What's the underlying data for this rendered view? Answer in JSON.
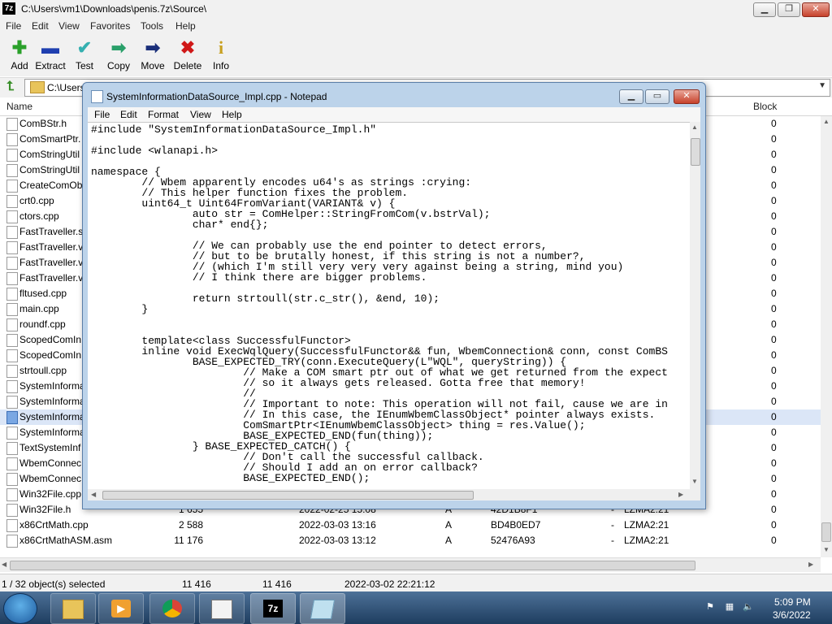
{
  "sevenzip": {
    "title": "C:\\Users\\vm1\\Downloads\\penis.7z\\Source\\",
    "app_icon": "7z",
    "menu": [
      "File",
      "Edit",
      "View",
      "Favorites",
      "Tools",
      "Help"
    ],
    "toolbar": [
      {
        "label": "Add",
        "icon": "plus-icon",
        "glyph": "✚",
        "color": "#2aa02a"
      },
      {
        "label": "Extract",
        "icon": "minus-icon",
        "glyph": "▬",
        "color": "#1f3fb0"
      },
      {
        "label": "Test",
        "icon": "checkmark-icon",
        "glyph": "✔",
        "color": "#35b0b0"
      },
      {
        "label": "Copy",
        "icon": "copy-arrow-icon",
        "glyph": "➡",
        "color": "#2aa06a"
      },
      {
        "label": "Move",
        "icon": "move-arrow-icon",
        "glyph": "➡",
        "color": "#1a2f7a"
      },
      {
        "label": "Delete",
        "icon": "delete-x-icon",
        "glyph": "✖",
        "color": "#d01818"
      },
      {
        "label": "Info",
        "icon": "info-icon",
        "glyph": "i",
        "color": "#c8a020"
      }
    ],
    "address": "C:\\Users",
    "columns": {
      "name": "Name",
      "block": "Block"
    },
    "files": [
      {
        "name": "ComBStr.h",
        "block": "0"
      },
      {
        "name": "ComSmartPtr.",
        "block": "0"
      },
      {
        "name": "ComStringUtil",
        "block": "0"
      },
      {
        "name": "ComStringUtil",
        "block": "0"
      },
      {
        "name": "CreateComOb",
        "block": "0"
      },
      {
        "name": "crt0.cpp",
        "block": "0"
      },
      {
        "name": "ctors.cpp",
        "block": "0"
      },
      {
        "name": "FastTraveller.sl",
        "block": "0"
      },
      {
        "name": "FastTraveller.v",
        "block": "0"
      },
      {
        "name": "FastTraveller.v",
        "block": "0"
      },
      {
        "name": "FastTraveller.v",
        "block": "0"
      },
      {
        "name": "fltused.cpp",
        "block": "0"
      },
      {
        "name": "main.cpp",
        "block": "0"
      },
      {
        "name": "roundf.cpp",
        "block": "0"
      },
      {
        "name": "ScopedComIn",
        "block": "0"
      },
      {
        "name": "ScopedComIn",
        "block": "0"
      },
      {
        "name": "strtoull.cpp",
        "block": "0"
      },
      {
        "name": "SystemInforma",
        "block": "0"
      },
      {
        "name": "SystemInforma",
        "block": "0"
      },
      {
        "name": "SystemInforma",
        "block": "0",
        "selected": true
      },
      {
        "name": "SystemInforma",
        "block": "0"
      },
      {
        "name": "TextSystemInf",
        "block": "0"
      },
      {
        "name": "WbemConnec",
        "block": "0"
      },
      {
        "name": "WbemConnec",
        "block": "0"
      },
      {
        "name": "Win32File.cpp",
        "block": "0"
      },
      {
        "name": "Win32File.h",
        "size": "1 655",
        "date": "2022-02-25 15:08",
        "attr": "A",
        "crc": "42D1B8F1",
        "dash": "-",
        "method": "LZMA2:21",
        "block": "0"
      },
      {
        "name": "x86CrtMath.cpp",
        "size": "2 588",
        "date": "2022-03-03 13:16",
        "attr": "A",
        "crc": "BD4B0ED7",
        "dash": "-",
        "method": "LZMA2:21",
        "block": "0"
      },
      {
        "name": "x86CrtMathASM.asm",
        "size": "11 176",
        "date": "2022-03-03 13:12",
        "attr": "A",
        "crc": "52476A93",
        "dash": "-",
        "method": "LZMA2:21",
        "block": "0"
      }
    ],
    "status": {
      "selection": "1 / 32 object(s) selected",
      "size": "11 416",
      "packed": "11 416",
      "modified": "2022-03-02 22:21:12"
    }
  },
  "notepad": {
    "title": "SystemInformationDataSource_Impl.cpp - Notepad",
    "menu": [
      "File",
      "Edit",
      "Format",
      "View",
      "Help"
    ],
    "content": "#include \"SystemInformationDataSource_Impl.h\"\n\n#include <wlanapi.h>\n\nnamespace {\n        // Wbem apparently encodes u64's as strings :crying:\n        // This helper function fixes the problem.\n        uint64_t Uint64FromVariant(VARIANT& v) {\n                auto str = ComHelper::StringFromCom(v.bstrVal);\n                char* end{};\n\n                // We can probably use the end pointer to detect errors,\n                // but to be brutally honest, if this string is not a number?,\n                // (which I'm still very very very against being a string, mind you)\n                // I think there are bigger problems.\n\n                return strtoull(str.c_str(), &end, 10);\n        }\n\n\n        template<class SuccessfulFunctor>\n        inline void ExecWqlQuery(SuccessfulFunctor&& fun, WbemConnection& conn, const ComBS\n                BASE_EXPECTED_TRY(conn.ExecuteQuery(L\"WQL\", queryString)) {\n                        // Make a COM smart ptr out of what we get returned from the expect\n                        // so it always gets released. Gotta free that memory!\n                        //\n                        // Important to note: This operation will not fail, cause we are in\n                        // In this case, the IEnumWbemClassObject* pointer always exists.\n                        ComSmartPtr<IEnumWbemClassObject> thing = res.Value();\n                        BASE_EXPECTED_END(fun(thing));\n                } BASE_EXPECTED_CATCH() {\n                        // Don't call the successful callback.\n                        // Should I add an on error callback?\n                        BASE_EXPECTED_END();"
  },
  "taskbar": {
    "time": "5:09 PM",
    "date": "3/6/2022",
    "app_7zip": "7z"
  }
}
